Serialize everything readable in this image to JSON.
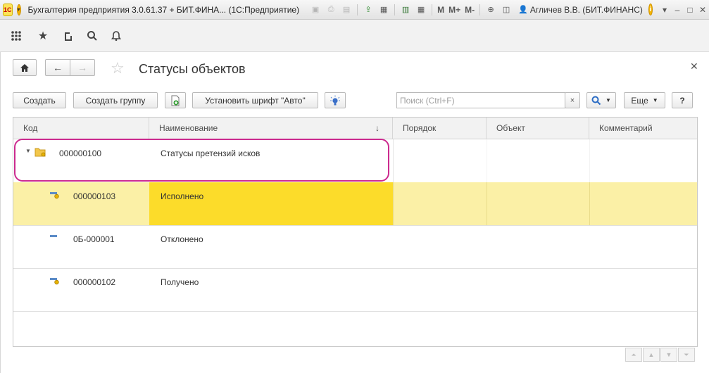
{
  "titlebar": {
    "app_title": "Бухгалтерия предприятия 3.0.61.37 + БИТ.ФИНА...  (1С:Предприятие)",
    "logo_text": "1С",
    "m_label": "M",
    "m_plus_label": "M+",
    "m_minus_label": "M-",
    "user": "Агличев В.В. (БИТ.ФИНАНС)"
  },
  "form": {
    "title": "Статусы объектов",
    "buttons": {
      "create": "Создать",
      "create_group": "Создать группу",
      "set_font": "Установить шрифт \"Авто\"",
      "more": "Еще",
      "help": "?"
    },
    "search_placeholder": "Поиск (Ctrl+F)",
    "search_clear": "×"
  },
  "table": {
    "columns": [
      "Код",
      "Наименование",
      "Порядок",
      "Объект",
      "Комментарий"
    ],
    "sort_indicator": "↓",
    "rows": [
      {
        "code": "000000100",
        "name": "Статусы претензий исков",
        "type": "group"
      },
      {
        "code": "000000103",
        "name": "Исполнено",
        "type": "item-marked",
        "selected": true
      },
      {
        "code": "0Б-000001",
        "name": "Отклонено",
        "type": "item"
      },
      {
        "code": "000000102",
        "name": "Получено",
        "type": "item-marked"
      }
    ]
  },
  "colors": {
    "selected_row": "#fbf0a6",
    "current_cell": "#fcdc2a",
    "highlight_outline": "#cc2b8f"
  }
}
